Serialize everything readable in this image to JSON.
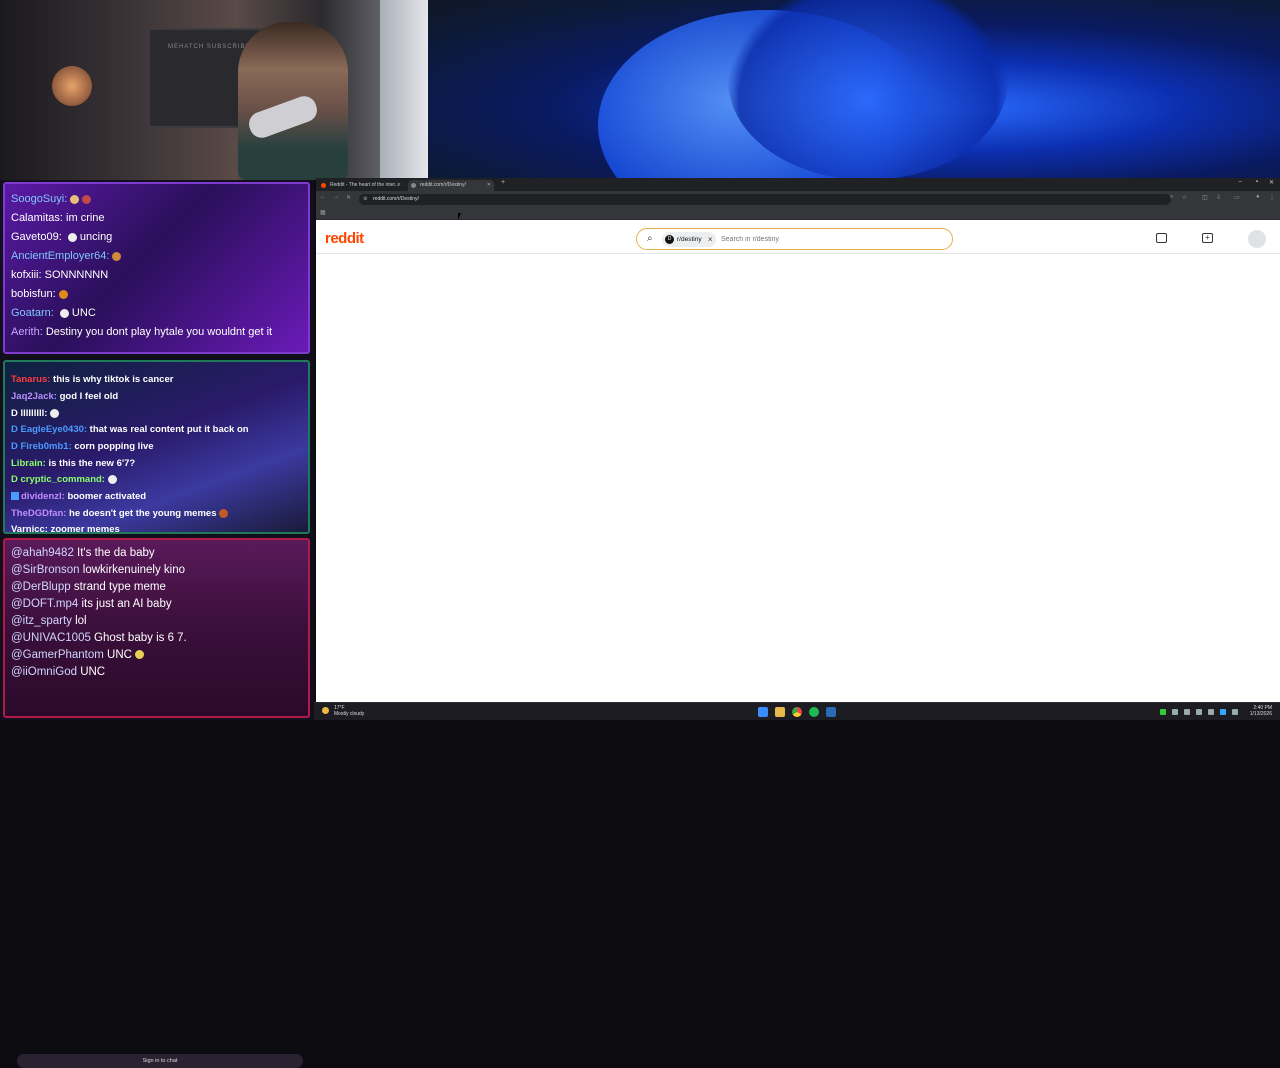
{
  "webcam": {
    "monitor_text": "MEHATCH SUBSCRIBERS"
  },
  "chat_top": [
    {
      "user": "SoogoSuyi:",
      "msg": "",
      "color": "#7ec8ff"
    },
    {
      "user": "Calamitas:",
      "msg": " im crine",
      "color": "#ffffff"
    },
    {
      "user": "Gaveto09:",
      "msg": " uncing",
      "color": "#ffffff"
    },
    {
      "user": "AncientEmployer64:",
      "msg": "",
      "color": "#7ec8ff"
    },
    {
      "user": "kofxiii:",
      "msg": " SONNNNNN",
      "color": "#ffffff"
    },
    {
      "user": "bobisfun:",
      "msg": "",
      "color": "#ffffff"
    },
    {
      "user": "Goatarn:",
      "msg": " UNC",
      "color": "#7ec8ff"
    },
    {
      "user": "Aerith:",
      "msg": " Destiny you dont play hytale you wouldnt get it",
      "color": "#c8a8ff"
    }
  ],
  "chat_mid": [
    {
      "user": "Tanarus:",
      "msg": " this is why tiktok is cancer",
      "color": "#ff3b3b"
    },
    {
      "user": "Jaq2Jack:",
      "msg": " god I feel old",
      "color": "#b98cff"
    },
    {
      "user": "D lllllllll:",
      "msg": "",
      "color": "#ffffff"
    },
    {
      "user": "D EagleEye0430:",
      "msg": " that was real content put it back on",
      "color": "#4a9bff"
    },
    {
      "user": "D Fireb0mb1:",
      "msg": " corn popping live",
      "color": "#4a9bff"
    },
    {
      "user": "Librain:",
      "msg": " is this the new 6'7?",
      "color": "#8aff6a"
    },
    {
      "user": "D cryptic_command:",
      "msg": "",
      "color": "#8aff6a"
    },
    {
      "user": "dividenzl:",
      "msg": " boomer activated",
      "color": "#c28cff"
    },
    {
      "user": "TheDGDfan:",
      "msg": " he doesn't get the young memes",
      "color": "#c28cff"
    },
    {
      "user": "Varnicc:",
      "msg": " zoomer memes",
      "color": "#ffffff"
    }
  ],
  "chat_bottom": [
    {
      "user": "@ahah9482",
      "msg": " It's the da baby"
    },
    {
      "user": "@SirBronson",
      "msg": " lowkirkenuinely kino"
    },
    {
      "user": "@DerBlupp",
      "msg": " strand type meme"
    },
    {
      "user": "@DOFT.mp4",
      "msg": " its just an AI baby"
    },
    {
      "user": "@itz_sparty",
      "msg": " lol"
    },
    {
      "user": "@UNIVAC1005",
      "msg": " Ghost baby is 6 7."
    },
    {
      "user": "@GamerPhantom",
      "msg": " UNC"
    },
    {
      "user": "@iiOmniGod",
      "msg": " UNC"
    }
  ],
  "chat_signin": "Sign in to chat",
  "browser": {
    "tab1_title": "Reddit - The heart of the inter...",
    "tab2_title": "reddit.com/r/Destiny/",
    "url": "reddit.com/r/Destiny/"
  },
  "reddit": {
    "logo": "reddit",
    "chip_label": "r/destiny",
    "search_placeholder": "Search in r/destiny"
  },
  "taskbar": {
    "weather_temp": "17°F",
    "weather_desc": "Mostly cloudy",
    "time": "2:40 PM",
    "date": "1/13/2026"
  },
  "colors": {
    "reddit_orange": "#ff4500",
    "search_border": "#e8b04a"
  }
}
